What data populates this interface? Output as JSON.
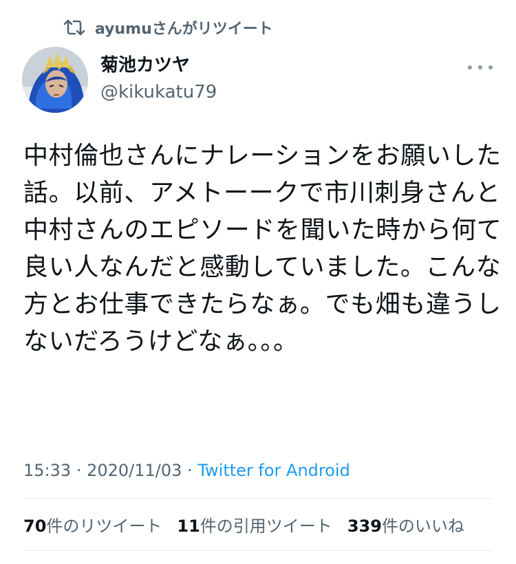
{
  "retweet_header": {
    "icon": "retweet-icon",
    "text": "ayumuさんがリツイート"
  },
  "author": {
    "name": "菊池カツヤ",
    "handle": "@kikukatu79",
    "avatar_icon": "avatar-image"
  },
  "more_icon": "more-horizontal-icon",
  "tweet": {
    "text": "中村倫也さんにナレーションをお願いした話。以前、アメトーークで市川刺身さんと中村さんのエピソードを聞いた時から何て良い人なんだと感動していました。こんな方とお仕事できたらなぁ。でも畑も違うしないだろうけどなぁ。。。"
  },
  "meta": {
    "time": "15:33",
    "separator": "·",
    "date": "2020/11/03",
    "source": "Twitter for Android"
  },
  "stats": {
    "retweets": {
      "count": "70",
      "label": "件のリツイート"
    },
    "quotes": {
      "count": "11",
      "label": "件の引用ツイート"
    },
    "likes": {
      "count": "339",
      "label": "件のいいね"
    }
  },
  "colors": {
    "link": "#1d9bf0",
    "secondary_text": "#536471",
    "primary_text": "#0f1419",
    "divider": "#e1e8ed"
  }
}
